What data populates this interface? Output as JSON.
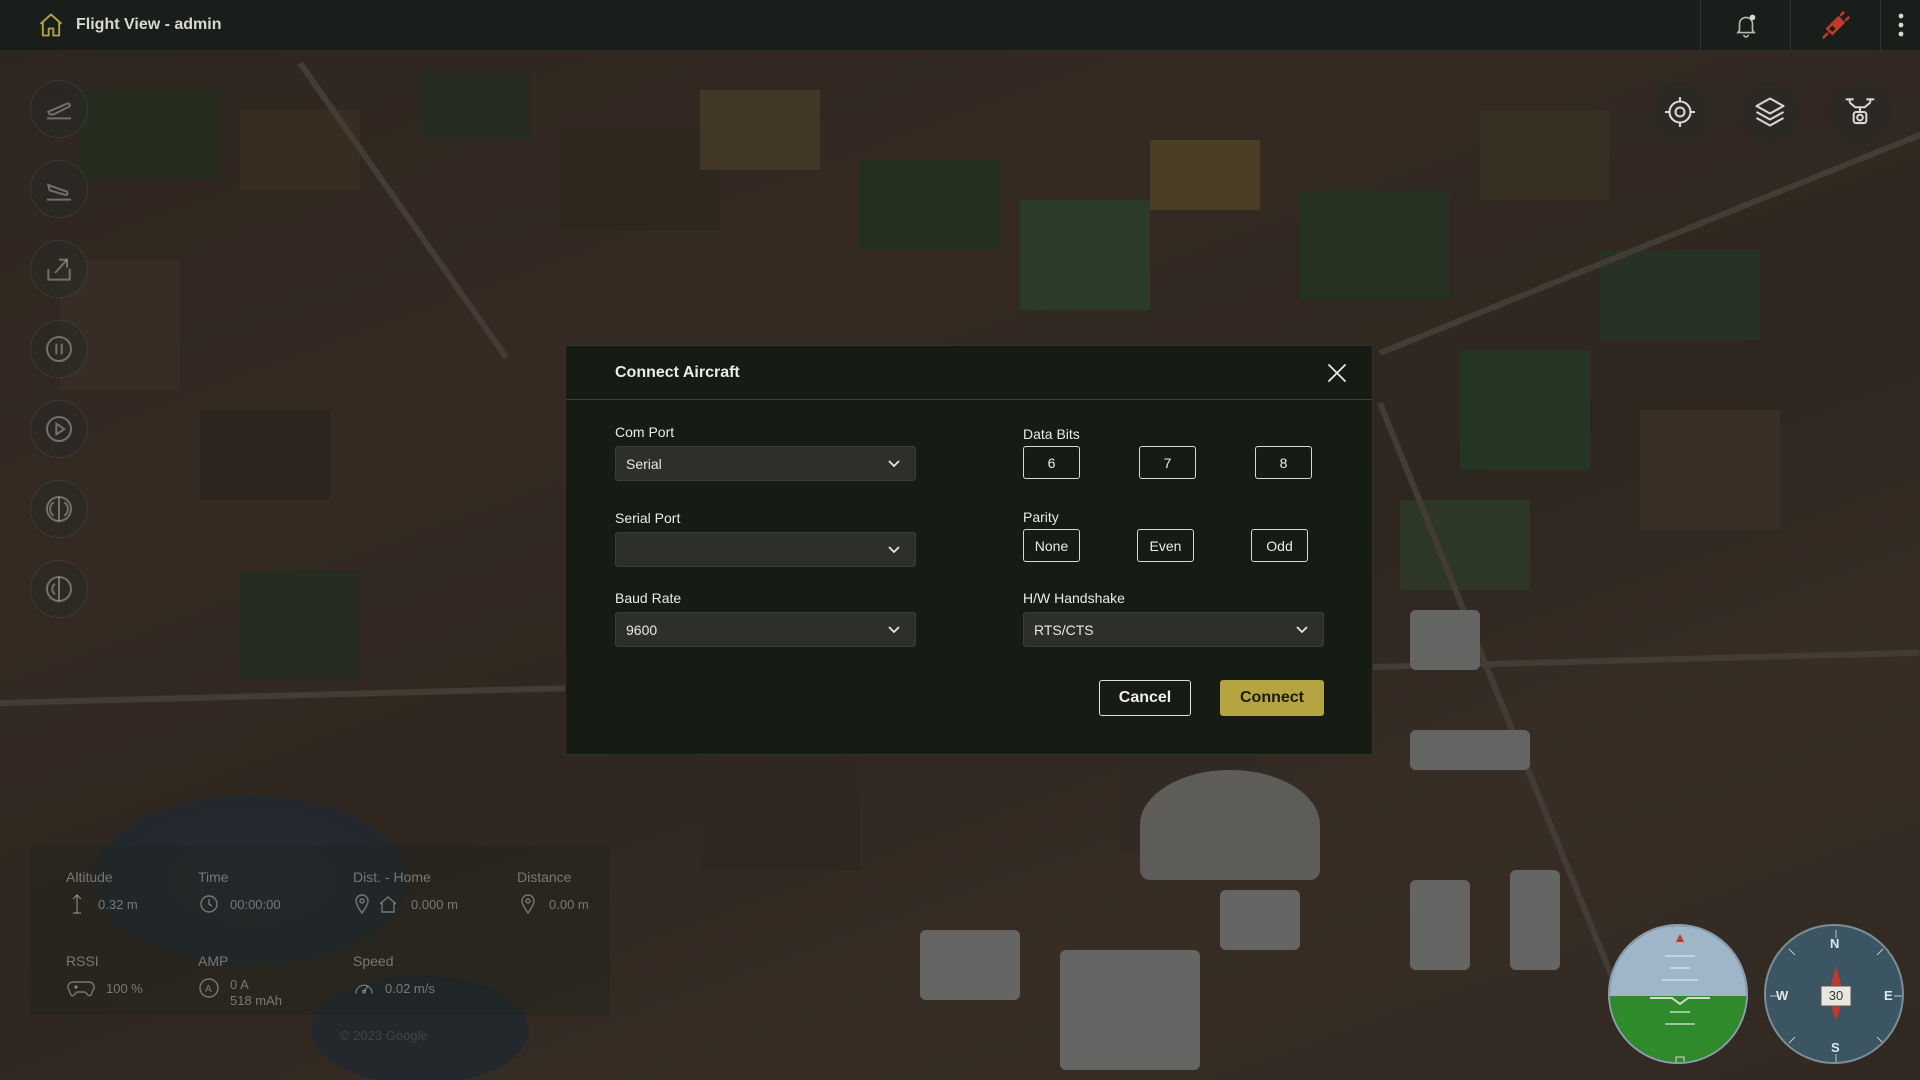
{
  "app": {
    "title": "Flight View - admin"
  },
  "telemetry": {
    "altitude": {
      "label": "Altitude",
      "value": "0.32 m"
    },
    "time": {
      "label": "Time",
      "value": "00:00:00"
    },
    "dist_home": {
      "label": "Dist. - Home",
      "value": "0.000 m"
    },
    "distance": {
      "label": "Distance",
      "value": "0.00 m"
    },
    "rssi": {
      "label": "RSSI",
      "value": "100 %"
    },
    "amp": {
      "label": "AMP",
      "value_current": "0 A",
      "value_capacity": "518 mAh"
    },
    "speed": {
      "label": "Speed",
      "value": "0.02 m/s"
    }
  },
  "map": {
    "attribution": "© 2023 Google"
  },
  "compass": {
    "heading": "30",
    "n": "N",
    "e": "E",
    "s": "S",
    "w": "W"
  },
  "dialog": {
    "title": "Connect Aircraft",
    "com_port": {
      "label": "Com Port",
      "value": "Serial"
    },
    "serial_port": {
      "label": "Serial Port",
      "value": ""
    },
    "baud_rate": {
      "label": "Baud Rate",
      "value": "9600"
    },
    "data_bits": {
      "label": "Data Bits",
      "options": [
        "6",
        "7",
        "8"
      ]
    },
    "parity": {
      "label": "Parity",
      "options": [
        "None",
        "Even",
        "Odd"
      ]
    },
    "hw_handshake": {
      "label": "H/W Handshake",
      "value": "RTS/CTS"
    },
    "cancel_label": "Cancel",
    "connect_label": "Connect"
  },
  "colors": {
    "accent": "#b5a541",
    "topbar": "#1a1e1a",
    "dialog_bg": "#161b14",
    "alert_red": "#c0392b"
  }
}
